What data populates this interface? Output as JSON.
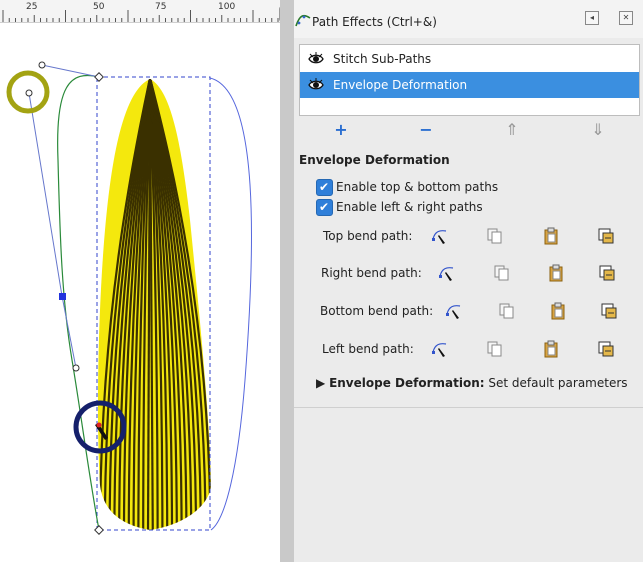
{
  "ruler": {
    "labels": [
      "25",
      "50",
      "75",
      "100"
    ]
  },
  "panel": {
    "title": "Path Effects (Ctrl+&)",
    "effects": [
      {
        "label": "Stitch Sub-Paths",
        "visible": true,
        "selected": false
      },
      {
        "label": "Envelope Deformation",
        "visible": true,
        "selected": true
      }
    ],
    "toolbar": {
      "add": "+",
      "remove": "−",
      "up": "⇑",
      "down": "⇓"
    },
    "section_title": "Envelope Deformation",
    "checks": [
      {
        "label": "Enable top & bottom paths",
        "checked": true
      },
      {
        "label": "Enable left & right paths",
        "checked": true
      }
    ],
    "bend_rows": [
      {
        "label": "Top bend path:"
      },
      {
        "label": "Right bend path:"
      },
      {
        "label": "Bottom bend path:"
      },
      {
        "label": "Left bend path:"
      }
    ],
    "expander": {
      "bold": "Envelope Deformation:",
      "rest": " Set default parameters"
    }
  },
  "colors": {
    "selection": "#3b8fe0",
    "shape_fill": "#f4e80d",
    "shape_stripes": "#3a3000",
    "check": "#2f7fd9"
  },
  "icons": [
    "path-effects-icon",
    "eye-icon",
    "edit-path-icon",
    "copy-icon",
    "paste-icon",
    "link-icon"
  ]
}
